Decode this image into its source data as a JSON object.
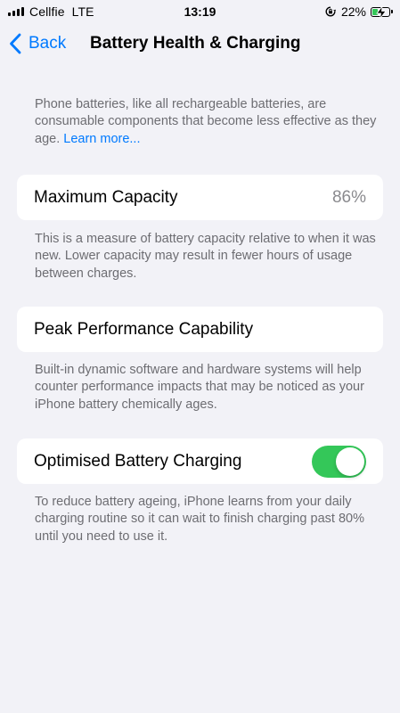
{
  "status_bar": {
    "carrier": "Cellfie",
    "network": "LTE",
    "time": "13:19",
    "battery_percent": "22%"
  },
  "nav": {
    "back_label": "Back",
    "title": "Battery Health & Charging"
  },
  "intro": {
    "text": "Phone batteries, like all rechargeable batteries, are consumable components that become less effective as they age. ",
    "link": "Learn more..."
  },
  "max_capacity": {
    "label": "Maximum Capacity",
    "value": "86%",
    "footnote": "This is a measure of battery capacity relative to when it was new. Lower capacity may result in fewer hours of usage between charges."
  },
  "peak_performance": {
    "label": "Peak Performance Capability",
    "footnote": "Built-in dynamic software and hardware systems will help counter performance impacts that may be noticed as your iPhone battery chemically ages."
  },
  "optimised_charging": {
    "label": "Optimised Battery Charging",
    "enabled": true,
    "footnote": "To reduce battery ageing, iPhone learns from your daily charging routine so it can wait to finish charging past 80% until you need to use it."
  },
  "icons": {
    "signal": "signal-bars-icon",
    "rotation_lock": "rotation-lock-icon",
    "battery": "battery-charging-icon",
    "back": "chevron-left-icon"
  },
  "colors": {
    "accent": "#007aff",
    "toggle_on": "#34c759",
    "background": "#f2f2f7",
    "secondary_text": "#6d6d72"
  }
}
